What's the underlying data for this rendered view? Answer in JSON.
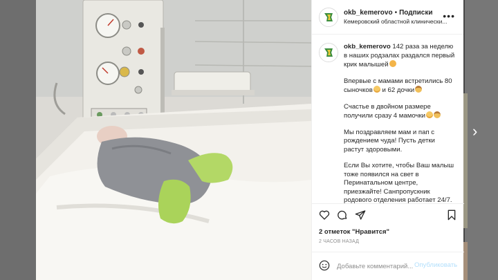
{
  "post": {
    "username": "okb_kemerovo",
    "follow_label": "Подписки",
    "location": "Кемеровский областной клинически...",
    "more_label": "•••"
  },
  "caption": {
    "username": "okb_kemerovo",
    "p1": "142 раза за неделю в наших родзалах раздался первый крик малышей",
    "p2": "Впервые с мамами встретились 80 сыночков",
    "p2b": "и 62 дочки",
    "p3": "Счастье в двойном размере получили сразу 4 мамочки",
    "p4": "Мы поздравляем мам и пап с рождением чуда! Пусть детки растут здоровыми.",
    "p5": "Если Вы хотите, чтобы Ваш малыш тоже появился на свет в Перинатальном центре, приезжайте! Санпропускник родового отделения работает 24/7."
  },
  "engagement": {
    "likes_text": "2 отметок \"Нравится\"",
    "time_text": "2 ЧАСОВ НАЗАД"
  },
  "comment": {
    "placeholder": "Добавьте комментарий...",
    "publish_label": "Опубликовать"
  },
  "nav": {
    "next_label": "›"
  },
  "icons": [
    "heart-icon",
    "comment-icon",
    "share-icon",
    "bookmark-icon",
    "smile-icon",
    "more-icon",
    "next-arrow-icon"
  ],
  "colors": {
    "publish": "#b2dffc",
    "text": "#262626",
    "muted": "#8e8e8e",
    "logo_green": "#3a8d3d"
  }
}
